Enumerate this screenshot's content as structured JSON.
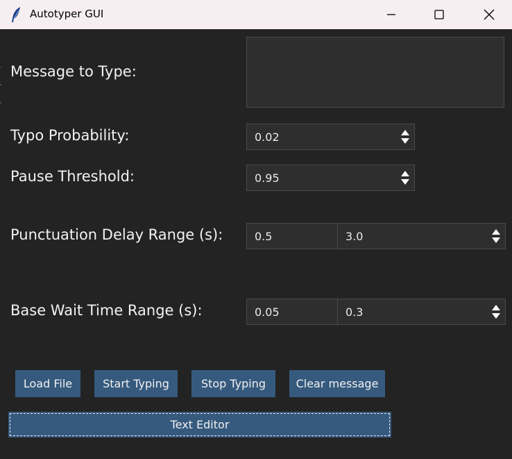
{
  "window": {
    "title": "Autotyper GUI",
    "icon": "feather-icon",
    "controls": [
      "minimize-icon",
      "maximize-icon",
      "close-icon"
    ]
  },
  "form": {
    "message_label": "Message to Type:",
    "message_value": "",
    "typo_label": "Typo Probability:",
    "typo_value": "0.02",
    "pause_label": "Pause Threshold:",
    "pause_value": "0.95",
    "punct_label": "Punctuation Delay Range (s):",
    "punct_min": "0.5",
    "punct_max": "3.0",
    "base_label": "Base Wait Time Range (s):",
    "base_min": "0.05",
    "base_max": "0.3"
  },
  "buttons": {
    "load_file": "Load File",
    "start_typing": "Start Typing",
    "stop_typing": "Stop Typing",
    "clear_message": "Clear message",
    "text_editor": "Text Editor"
  },
  "colors": {
    "background": "#232323",
    "input_bg": "#2e2e2e",
    "button_bg": "#365a7e",
    "titlebar_bg": "#f6eef0"
  }
}
